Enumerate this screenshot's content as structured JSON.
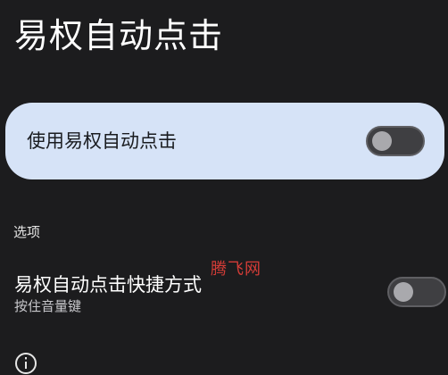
{
  "header": {
    "title": "易权自动点击"
  },
  "main_toggle": {
    "label": "使用易权自动点击",
    "enabled": false
  },
  "options_section": {
    "title": "选项",
    "shortcut": {
      "title": "易权自动点击快捷方式",
      "subtitle": "按住音量键",
      "enabled": false
    }
  },
  "watermark": {
    "text": "腾飞网"
  },
  "icons": {
    "info": "info-icon"
  },
  "colors": {
    "background": "#1c1c1e",
    "card": "#d6e3f7",
    "watermark": "#e8403a"
  }
}
